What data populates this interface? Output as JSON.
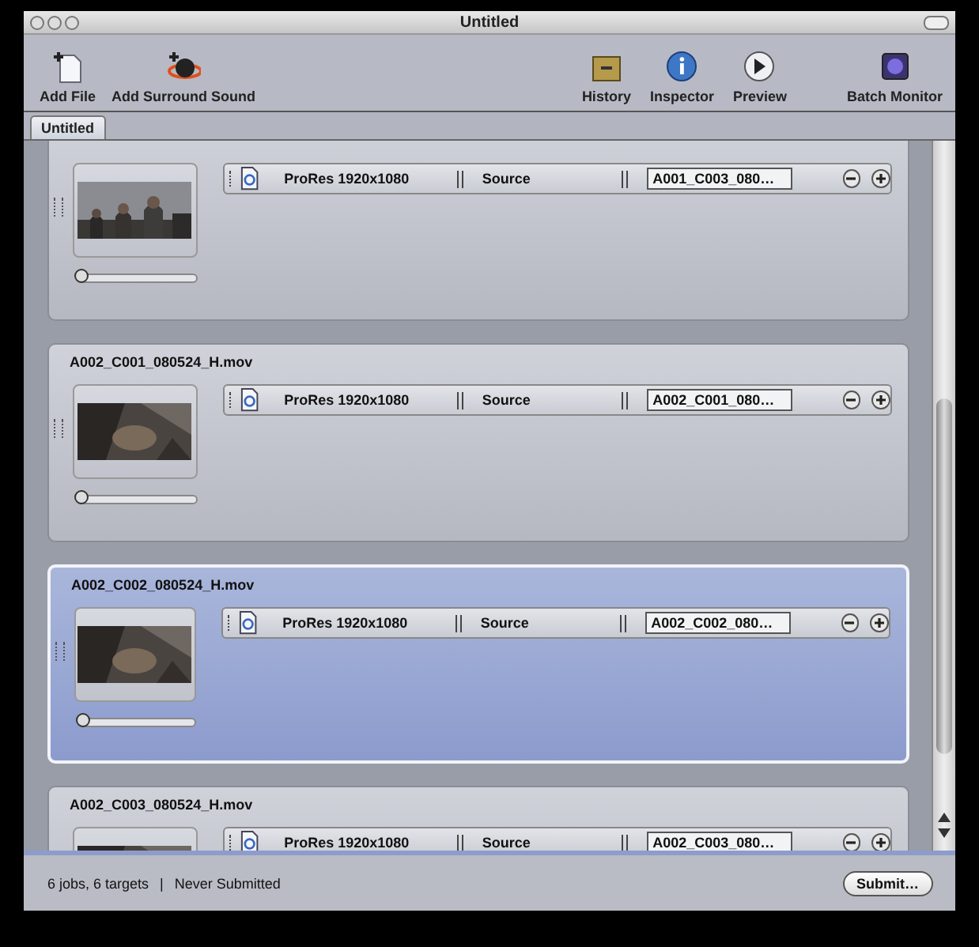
{
  "window": {
    "title": "Untitled"
  },
  "toolbar": {
    "left": [
      {
        "label": "Add File",
        "kind": "add-file"
      },
      {
        "label": "Add Surround Sound",
        "kind": "surround"
      }
    ],
    "right": [
      {
        "label": "History",
        "kind": "history"
      },
      {
        "label": "Inspector",
        "kind": "inspector"
      },
      {
        "label": "Preview",
        "kind": "preview"
      },
      {
        "label": "Batch Monitor",
        "kind": "monitor"
      }
    ]
  },
  "tabs": [
    {
      "label": "Untitled",
      "selected": true
    }
  ],
  "jobs": [
    {
      "selected": false,
      "level": 0,
      "targets": [
        {
          "setting": "ProRes 1920x1080",
          "destination": "Source",
          "output": "A001_C003_080…"
        }
      ]
    },
    {
      "name": "A002_C001_080524_H.mov",
      "selected": false,
      "level": 0,
      "targets": [
        {
          "setting": "ProRes 1920x1080",
          "destination": "Source",
          "output": "A002_C001_080…"
        }
      ]
    },
    {
      "name": "A002_C002_080524_H.mov",
      "selected": true,
      "level": 0,
      "targets": [
        {
          "setting": "ProRes 1920x1080",
          "destination": "Source",
          "output": "A002_C002_080…"
        }
      ]
    },
    {
      "name": "A002_C003_080524_H.mov",
      "selected": false,
      "targets": [
        {
          "setting": "ProRes 1920x1080",
          "destination": "Source",
          "output": "A002_C003_080…"
        }
      ]
    }
  ],
  "status_bar": {
    "summary": "6 jobs, 6 targets",
    "separator": "|",
    "state": "Never Submitted",
    "button": "Submit…"
  }
}
